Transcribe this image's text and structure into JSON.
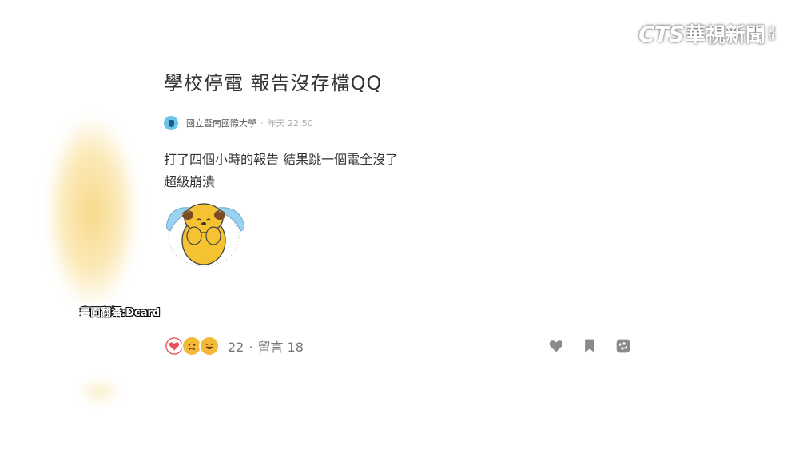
{
  "watermark": {
    "latin": "CTS",
    "cjk": "華視新聞",
    "small": "資訊"
  },
  "caption": "畫面翻攝:Dcard",
  "post": {
    "title": "學校停電 報告沒存檔QQ",
    "school": "國立暨南國際大學",
    "separator": "·",
    "time": "昨天 22:50",
    "body_lines": [
      "打了四個小時的報告 結果跳一個電全沒了",
      "超級崩潰"
    ]
  },
  "footer": {
    "reaction_count": "22",
    "separator": "·",
    "comments_label": "留言 18"
  },
  "icons": {
    "reactions": [
      "heart-icon",
      "sad-face-icon",
      "laugh-face-icon"
    ],
    "actions": [
      "like-icon",
      "bookmark-icon",
      "share-icon"
    ],
    "school": "school-badge-icon"
  },
  "colors": {
    "heart": "#e9505a",
    "reaction_face": "#f5b93a",
    "action_icon": "#8a8a8a",
    "school_badge": "#6cc4ea"
  }
}
